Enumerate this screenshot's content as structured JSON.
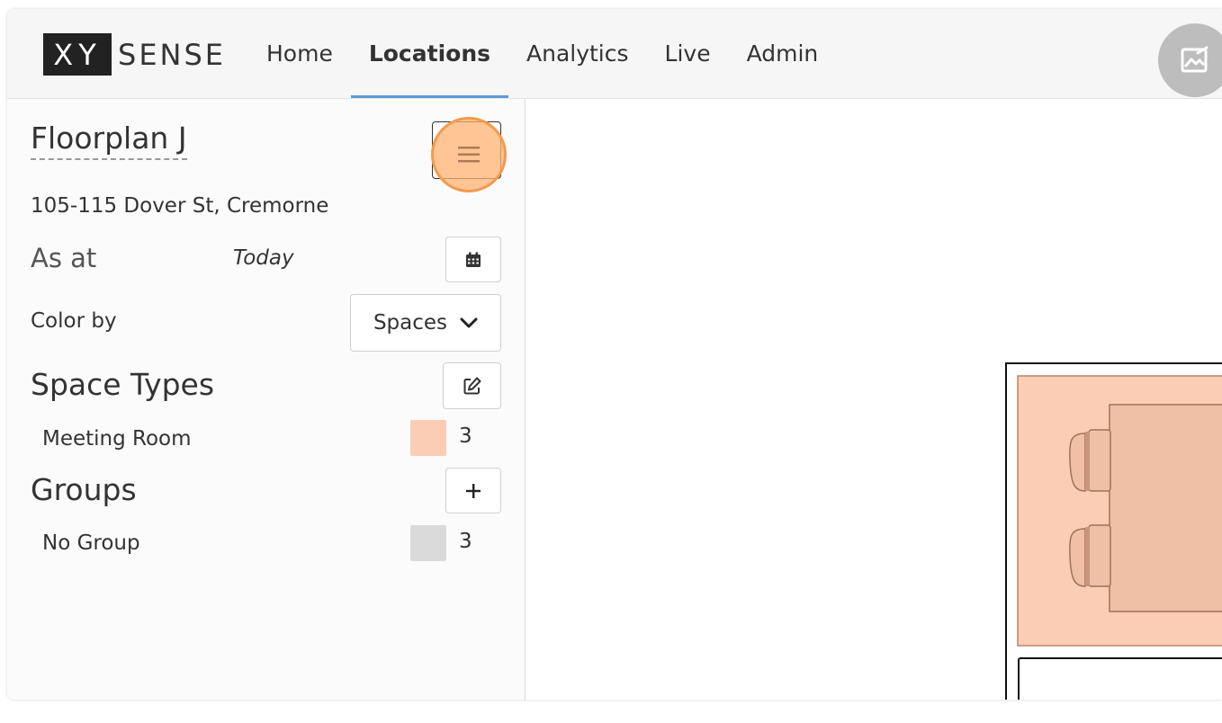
{
  "brand": {
    "logo_box": "XY",
    "logo_text": "SENSE"
  },
  "nav": {
    "items": [
      {
        "label": "Home"
      },
      {
        "label": "Locations"
      },
      {
        "label": "Analytics"
      },
      {
        "label": "Live"
      },
      {
        "label": "Admin"
      }
    ],
    "active": "Locations"
  },
  "avatar": {
    "icon": "image-edit-icon"
  },
  "sidebar": {
    "title": "Floorplan J",
    "address": "105-115 Dover St, Cremorne",
    "as_at_label": "As at",
    "as_at_value": "Today",
    "color_by_label": "Color by",
    "color_by_value": "Spaces",
    "space_types_heading": "Space Types",
    "space_types": [
      {
        "label": "Meeting Room",
        "count": "3",
        "color": "#fbcdb4"
      }
    ],
    "groups_heading": "Groups",
    "groups": [
      {
        "label": "No Group",
        "count": "3",
        "color": "#dadada"
      }
    ]
  },
  "colors": {
    "accent_underline": "#5b9bd5",
    "highlight": "#f39a4c",
    "room_fill": "#fbcdb4",
    "table_fill": "#efc0a5"
  }
}
